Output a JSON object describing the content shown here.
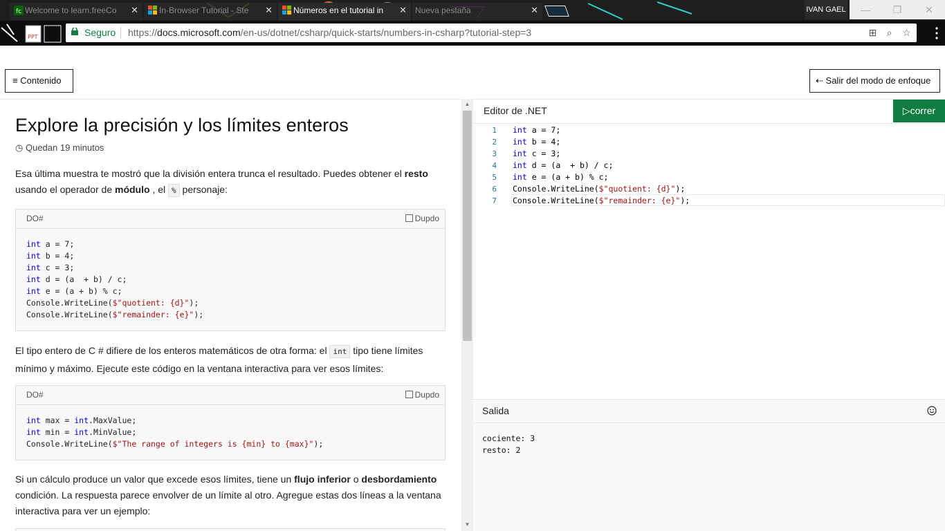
{
  "browser": {
    "tabs": [
      {
        "label": "Welcome to learn.freeCo",
        "active": false
      },
      {
        "label": "In-Browser Tutorial - Ste",
        "active": false
      },
      {
        "label": "Números en el tutorial in",
        "active": true
      },
      {
        "label": "Nueva pestaña",
        "active": false
      }
    ],
    "user": "IVAN GAEL",
    "secure_label": "Seguro",
    "url_prefix": "https://",
    "url_host": "docs.microsoft.com",
    "url_path": "/en-us/dotnet/csharp/quick-starts/numbers-in-csharp?tutorial-step=3",
    "window": {
      "minimize": "—",
      "restore": "❐",
      "close": "✕"
    }
  },
  "header": {
    "contents_label": "Contenido",
    "exit_focus_label": "Salir del modo de enfoque"
  },
  "article": {
    "title": "Explore la precisión y los límites enteros",
    "time_remaining": "Quedan 19 minutos",
    "para1": {
      "a": "Esa última muestra te mostró que la división entera trunca el resultado. Puedes obtener el ",
      "b1": "resto",
      "c": " usando el operador de ",
      "b2": "módulo",
      "d": " , el ",
      "code": "%",
      "e": " personaje:"
    },
    "code1": {
      "lang": "DO#",
      "copy": "Dupdo",
      "lines": [
        [
          "int",
          " a = 7;"
        ],
        [
          "int",
          " b = 4;"
        ],
        [
          "int",
          " c = 3;"
        ],
        [
          "int",
          " d = (a  + b) / c;"
        ],
        [
          "int",
          " e = (a + b) % c;"
        ]
      ],
      "wl1": [
        "Console.WriteLine(",
        "$\"quotient: {d}\"",
        ");"
      ],
      "wl2": [
        "Console.WriteLine(",
        "$\"remainder: {e}\"",
        ");"
      ]
    },
    "para2": {
      "a": "El tipo entero de C # difiere de los enteros matemáticos de otra forma: el ",
      "code": "int",
      "b": " tipo tiene límites mínimo y máximo. Ejecute este código en la ventana interactiva para ver esos límites:"
    },
    "code2": {
      "lang": "DO#",
      "copy": "Dupdo",
      "l1": [
        "int",
        " max = ",
        "int",
        ".MaxValue;"
      ],
      "l2": [
        "int",
        " min = ",
        "int",
        ".MinValue;"
      ],
      "l3": [
        "Console.WriteLine(",
        "$\"The range of integers is {min} to {max}\"",
        ");"
      ]
    },
    "para3": {
      "a": "Si un cálculo produce un valor que excede esos límites, tiene un ",
      "b1": "flujo inferior",
      "c": " o ",
      "b2": "desbordamiento",
      "d": " condición. La respuesta parece envolver de un límite al otro. Agregue estas dos líneas a la ventana interactiva para ver un ejemplo:"
    }
  },
  "editor": {
    "title": "Editor de .NET",
    "run_label": "correr",
    "line_numbers": [
      "1",
      "2",
      "3",
      "4",
      "5",
      "6",
      "7"
    ],
    "lines": [
      [
        "int",
        " a = 7;"
      ],
      [
        "int",
        " b = 4;"
      ],
      [
        "int",
        " c = 3;"
      ],
      [
        "int",
        " d = (a  + b) / c;"
      ],
      [
        "int",
        " e = (a + b) % c;"
      ]
    ],
    "wl1": [
      "Console.WriteLine(",
      "$\"quotient: {d}\"",
      ");"
    ],
    "wl2": [
      "Console.WriteLine(",
      "$\"remainder: {e}\"",
      ");"
    ]
  },
  "output": {
    "title": "Salida",
    "lines": [
      "cociente: 3",
      "resto: 2"
    ]
  },
  "colors": {
    "run_button": "#107c41",
    "keyword": "#0000ff",
    "string": "#a31515",
    "secure": "#0b8043"
  }
}
